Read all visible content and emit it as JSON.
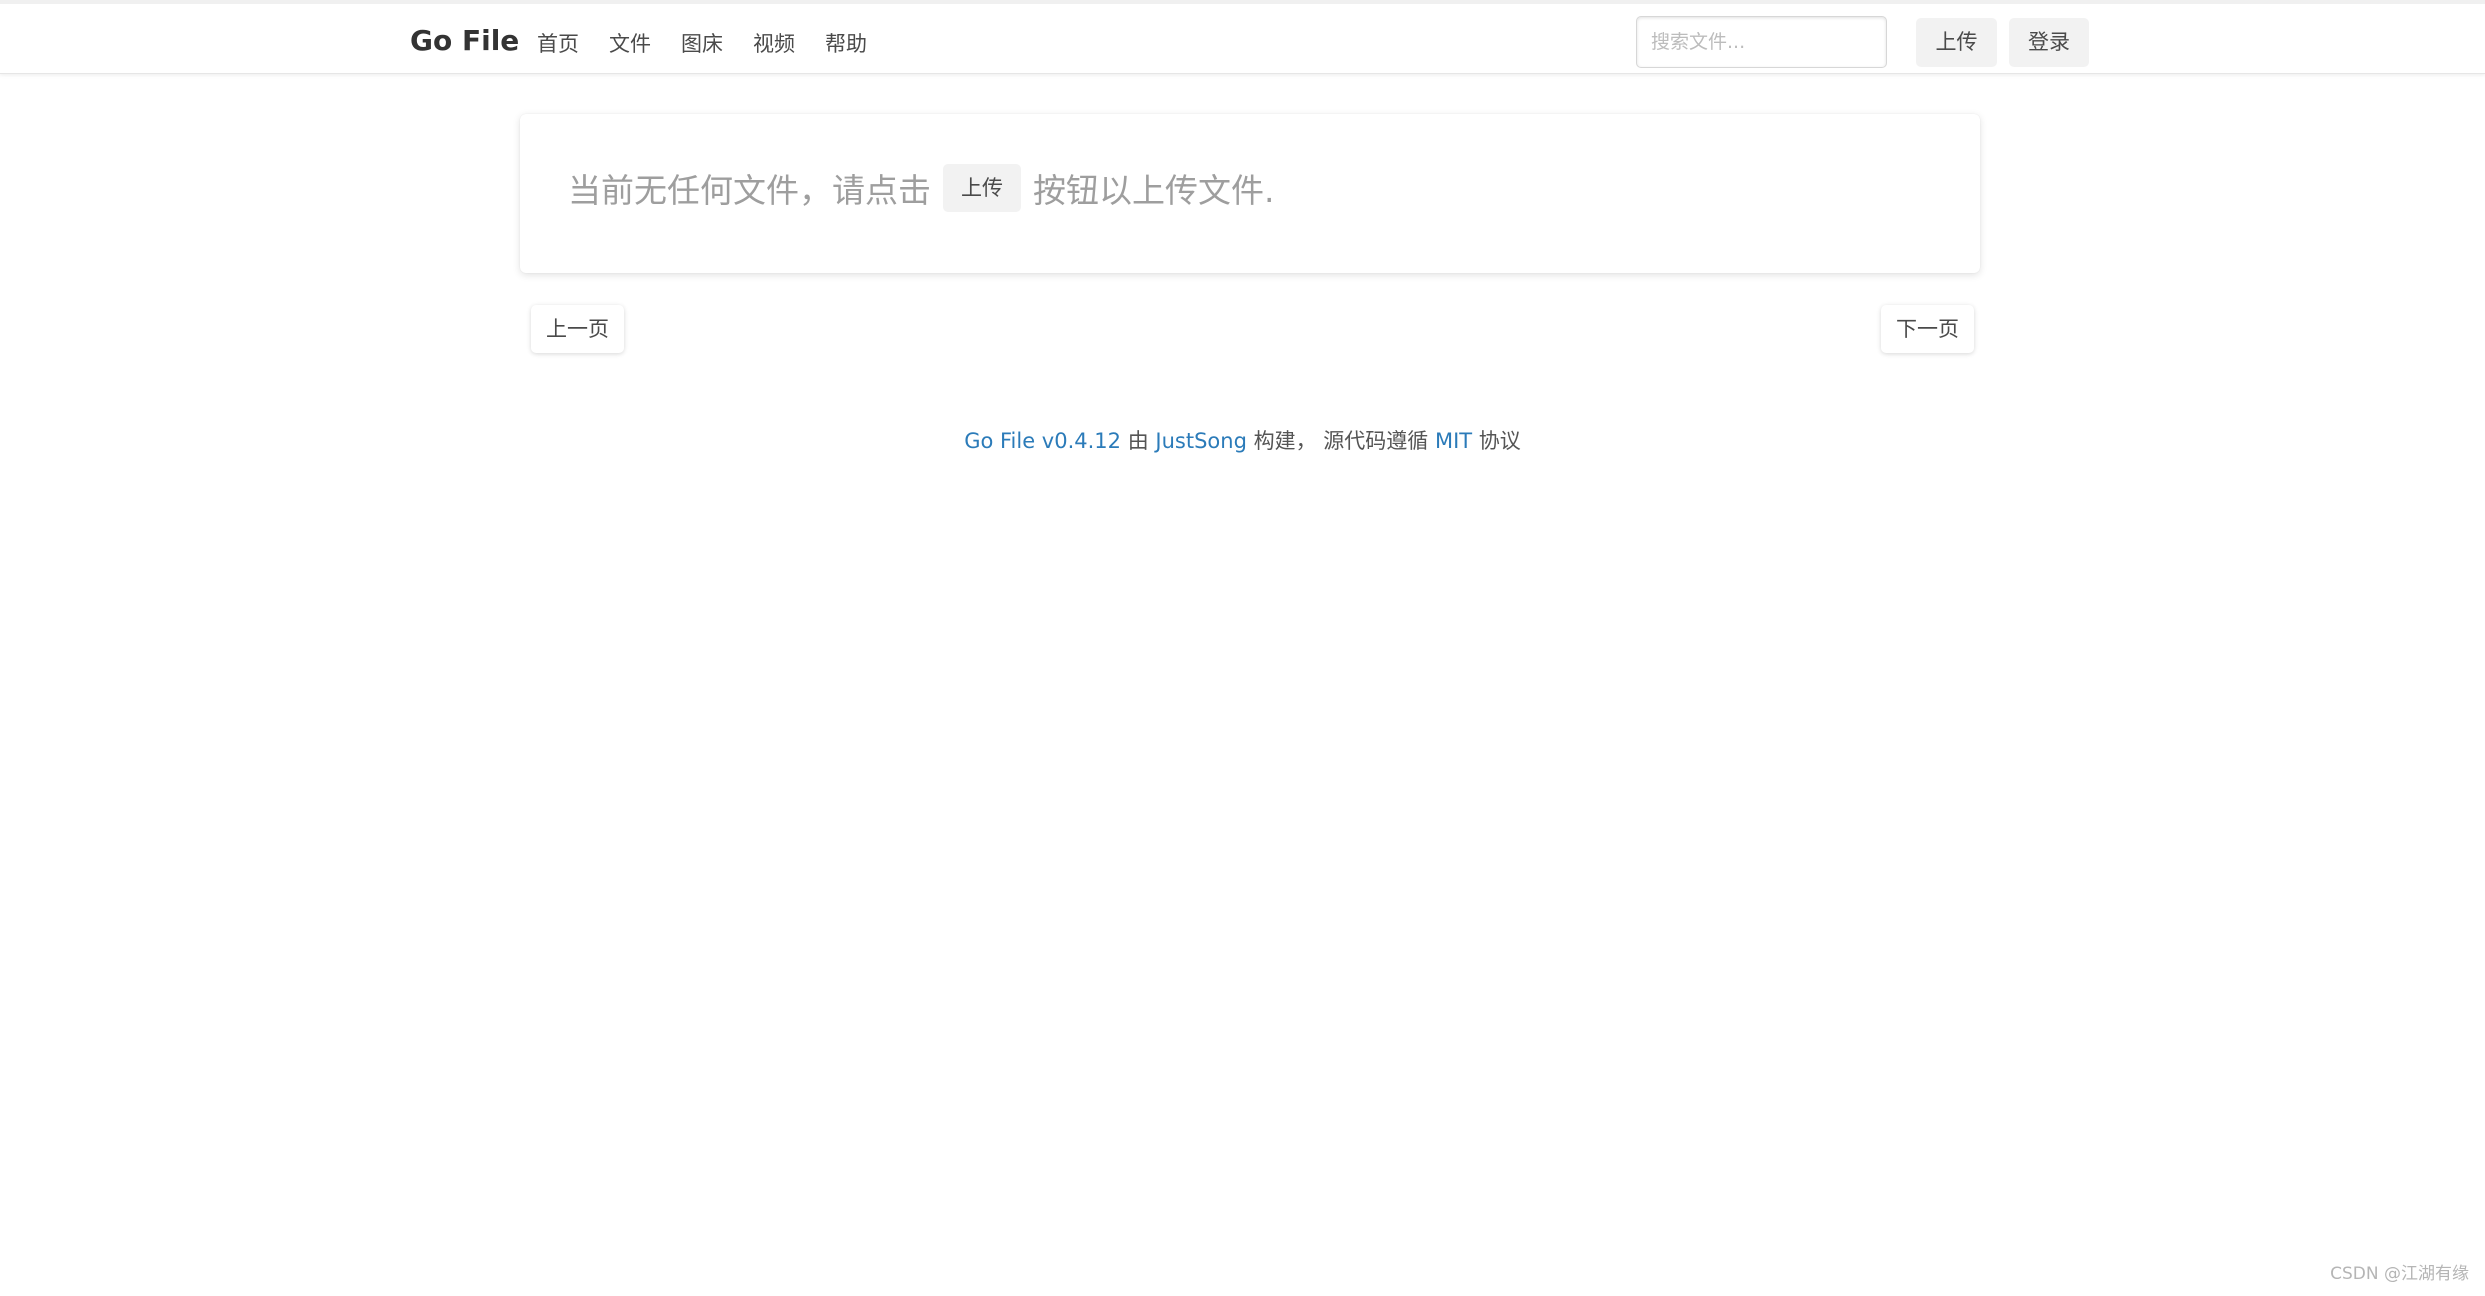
{
  "navbar": {
    "brand": "Go File",
    "items": [
      {
        "label": "首页"
      },
      {
        "label": "文件"
      },
      {
        "label": "图床"
      },
      {
        "label": "视频"
      },
      {
        "label": "帮助"
      }
    ],
    "search_placeholder": "搜索文件...",
    "upload_label": "上传",
    "login_label": "登录"
  },
  "empty_state": {
    "prefix": "当前无任何文件，请点击",
    "button_label": "上传",
    "suffix": "按钮以上传文件."
  },
  "pagination": {
    "prev_label": "上一页",
    "next_label": "下一页"
  },
  "footer": {
    "app_link": "Go File v0.4.12",
    "by_text": "由",
    "author_link": "JustSong",
    "built_text": "构建，",
    "license_prefix": "源代码遵循",
    "license_link": "MIT",
    "license_suffix": "协议"
  },
  "watermark": "CSDN @江湖有缘",
  "colors": {
    "link": "#2b7bb9",
    "button_bg": "#f2f2f2",
    "muted_text": "#9e9e9e"
  }
}
